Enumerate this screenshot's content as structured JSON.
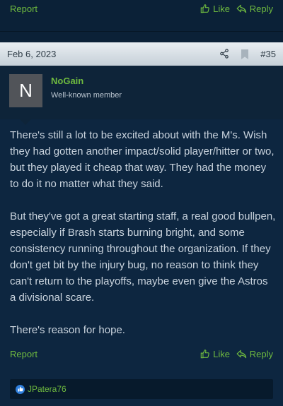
{
  "prev_actions": {
    "report": "Report",
    "like": "Like",
    "reply": "Reply"
  },
  "post": {
    "date": "Feb 6, 2023",
    "number": "#35",
    "author": {
      "initial": "N",
      "name": "NoGain",
      "title": "Well-known member"
    },
    "paragraphs": [
      "There's still a lot to be excited about with the M's. Wish they had gotten another impact/solid player/hitter or two, but they played it cheap that way. They had the money to do it no matter what they said.",
      "But they've got a great starting staff, a real good bullpen, especially if Brash starts burning bright, and some consistency running throughout the organization. If they don't get bit by the injury bug, no reason to think they can't return to the playoffs, maybe even give the Astros a divisional scare.",
      "There's reason for hope."
    ],
    "actions": {
      "report": "Report",
      "like": "Like",
      "reply": "Reply"
    },
    "reactions": {
      "users": "JPatera76"
    }
  },
  "icons": {
    "like": "thumbs-up-icon",
    "reply": "reply-arrow-icon",
    "share": "share-icon",
    "bookmark": "bookmark-icon"
  },
  "colors": {
    "accent": "#6fba3f",
    "background": "#0b2137",
    "header": "#d8dfe5"
  }
}
